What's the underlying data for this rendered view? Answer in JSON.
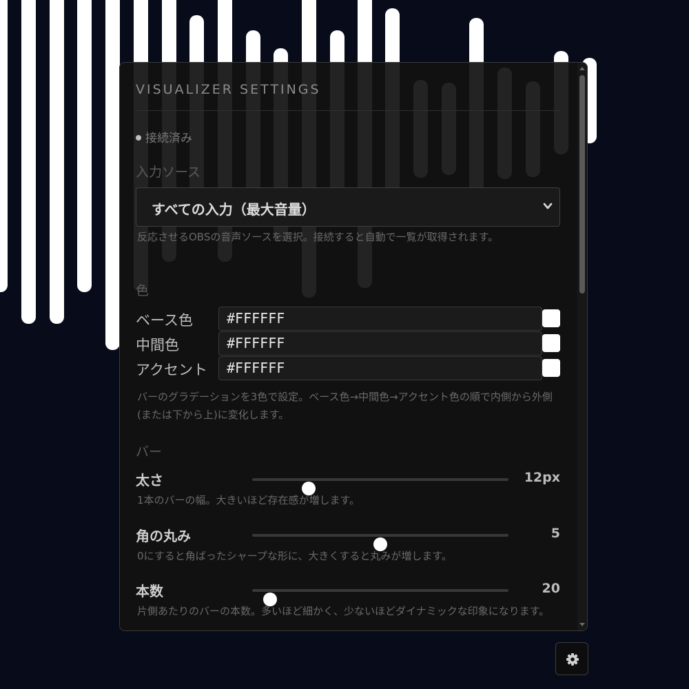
{
  "visualizer": {
    "bar_color": "#FFFFFF",
    "background_color": "#070B1A"
  },
  "panel": {
    "title": "VISUALIZER SETTINGS",
    "status": {
      "text": "接続済み"
    },
    "input_source": {
      "label": "入力ソース",
      "selected": "すべての入力（最大音量）",
      "help": "反応させるOBSの音声ソースを選択。接続すると自動で一覧が取得されます。"
    },
    "colors": {
      "label": "色",
      "items": [
        {
          "label": "ベース色",
          "value": "#FFFFFF"
        },
        {
          "label": "中間色",
          "value": "#FFFFFF"
        },
        {
          "label": "アクセント",
          "value": "#FFFFFF"
        }
      ],
      "help": "バーのグラデーションを3色で設定。ベース色→中間色→アクセント色の順で内側から外側(または下から上)に変化します。"
    },
    "bars": {
      "label": "バー",
      "sliders": [
        {
          "label": "太さ",
          "value": "12px",
          "fraction": 0.22,
          "help": "1本のバーの幅。大きいほど存在感が増します。"
        },
        {
          "label": "角の丸み",
          "value": "5",
          "fraction": 0.5,
          "help": "0にすると角ばったシャープな形に、大きくすると丸みが増します。"
        },
        {
          "label": "本数",
          "value": "20",
          "fraction": 0.07,
          "help": "片側あたりのバーの本数。多いほど細かく、少ないほどダイナミックな印象になります。"
        }
      ]
    }
  },
  "settings_button": {
    "icon": "gear-icon"
  }
}
